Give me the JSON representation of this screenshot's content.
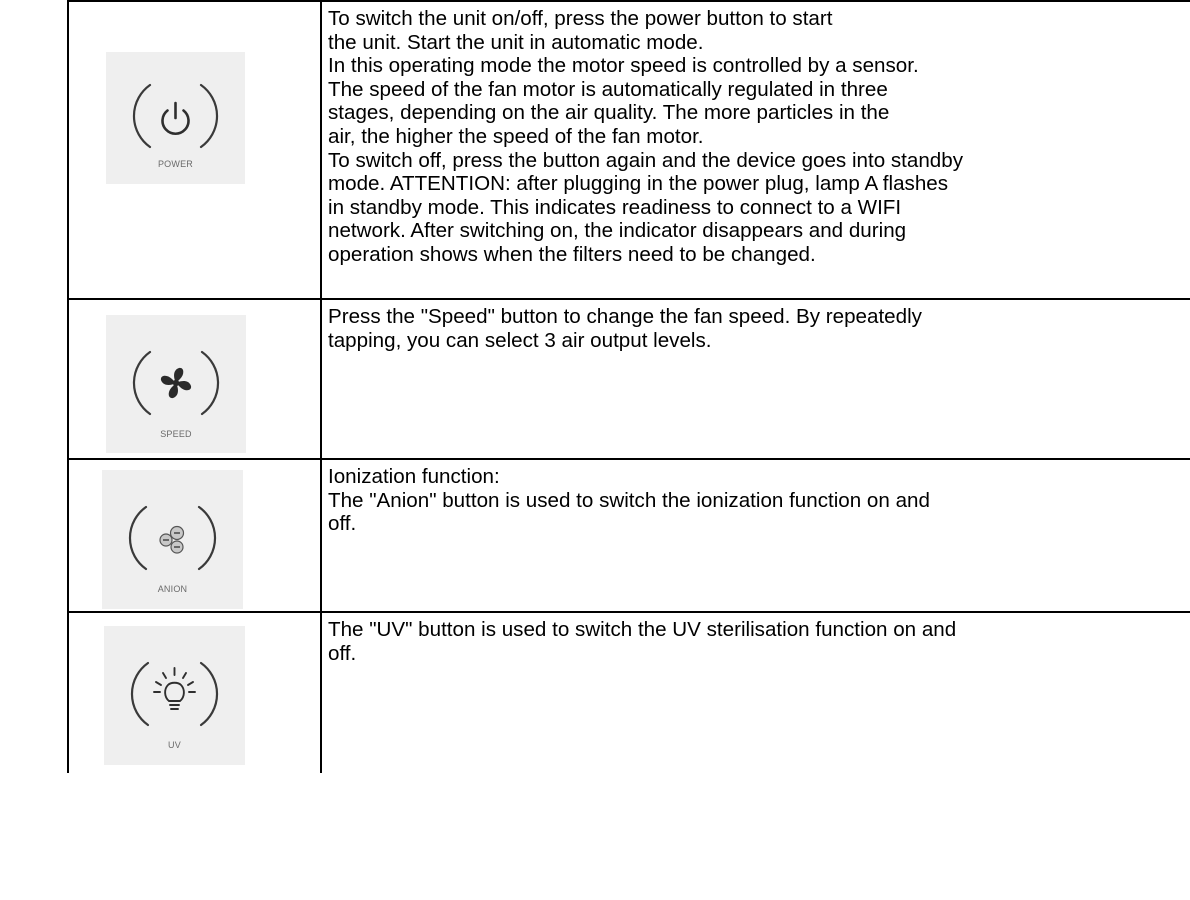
{
  "rows": [
    {
      "icon": "power-icon",
      "button_label": "POWER",
      "lines": [
        "To switch the unit on/off, press the power button to start",
        "the unit. Start the unit in automatic mode.",
        "In this operating mode the motor speed is controlled by a sensor.",
        "The speed of the fan motor is automatically regulated in three",
        "stages, depending on the air quality. The more particles in the",
        "air, the higher the speed of the fan motor.",
        "To switch off, press the button again and the device goes into standby",
        "mode. ATTENTION: after plugging in the power plug, lamp A flashes",
        "in standby mode. This indicates readiness to connect to a WIFI",
        "network. After switching on, the indicator disappears and during",
        "operation shows when the filters need to be changed."
      ]
    },
    {
      "icon": "fan-icon",
      "button_label": "SPEED",
      "lines": [
        "Press the \"Speed\" button to change the fan speed. By repeatedly",
        "tapping, you can select 3 air output levels."
      ]
    },
    {
      "icon": "anion-icon",
      "button_label": "ANION",
      "lines": [
        "Ionization function:",
        "The \"Anion\" button is used to switch the ionization function on and",
        "off."
      ]
    },
    {
      "icon": "uv-lamp-icon",
      "button_label": "UV",
      "lines": [
        "The \"UV\" button is used to switch the UV sterilisation function on and",
        "off."
      ]
    }
  ]
}
